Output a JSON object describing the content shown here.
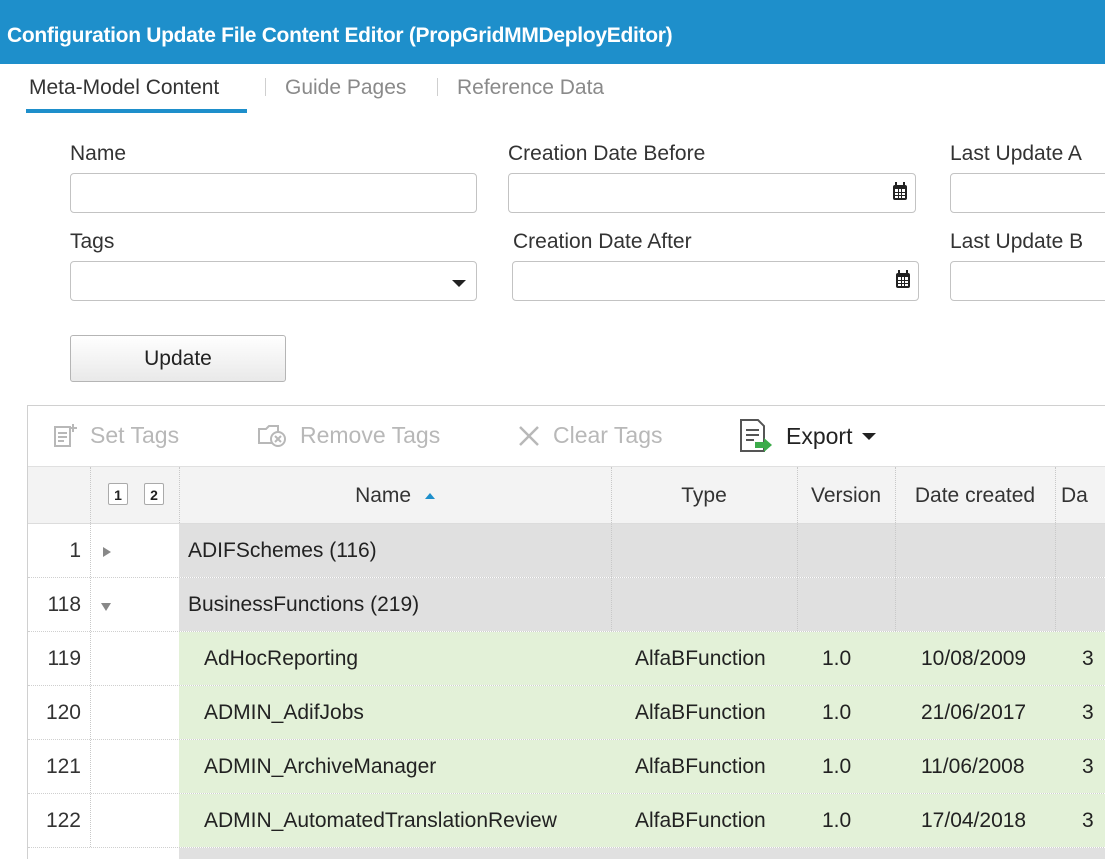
{
  "window": {
    "title": "Configuration Update File Content Editor (PropGridMMDeployEditor)"
  },
  "tabs": [
    {
      "label": "Meta-Model Content",
      "active": true
    },
    {
      "label": "Guide Pages",
      "active": false
    },
    {
      "label": "Reference Data",
      "active": false
    }
  ],
  "filters": {
    "name_label": "Name",
    "name_value": "",
    "creation_before_label": "Creation Date Before",
    "creation_before_value": "",
    "last_update_after_label": "Last Update A",
    "tags_label": "Tags",
    "tags_value": "",
    "creation_after_label": "Creation Date After",
    "creation_after_value": "",
    "last_update_before_label": "Last Update B",
    "update_button": "Update"
  },
  "toolbar": {
    "set_tags": "Set Tags",
    "remove_tags": "Remove Tags",
    "clear_tags": "Clear Tags",
    "export": "Export"
  },
  "grid": {
    "level_buttons": [
      "1",
      "2"
    ],
    "columns": {
      "name": "Name",
      "type": "Type",
      "version": "Version",
      "date_created": "Date created",
      "date_next": "Da"
    },
    "rows": [
      {
        "num": "1",
        "kind": "group",
        "expanded": false,
        "name": "ADIFSchemes (116)"
      },
      {
        "num": "118",
        "kind": "group",
        "expanded": true,
        "name": "BusinessFunctions (219)"
      },
      {
        "num": "119",
        "kind": "data",
        "name": "AdHocReporting",
        "type": "AlfaBFunction",
        "version": "1.0",
        "date_created": "10/08/2009",
        "next": "3"
      },
      {
        "num": "120",
        "kind": "data",
        "name": "ADMIN_AdifJobs",
        "type": "AlfaBFunction",
        "version": "1.0",
        "date_created": "21/06/2017",
        "next": "3"
      },
      {
        "num": "121",
        "kind": "data",
        "name": "ADMIN_ArchiveManager",
        "type": "AlfaBFunction",
        "version": "1.0",
        "date_created": "11/06/2008",
        "next": "3"
      },
      {
        "num": "122",
        "kind": "data",
        "name": "ADMIN_AutomatedTranslationReview",
        "type": "AlfaBFunction",
        "version": "1.0",
        "date_created": "17/04/2018",
        "next": "3"
      }
    ]
  }
}
